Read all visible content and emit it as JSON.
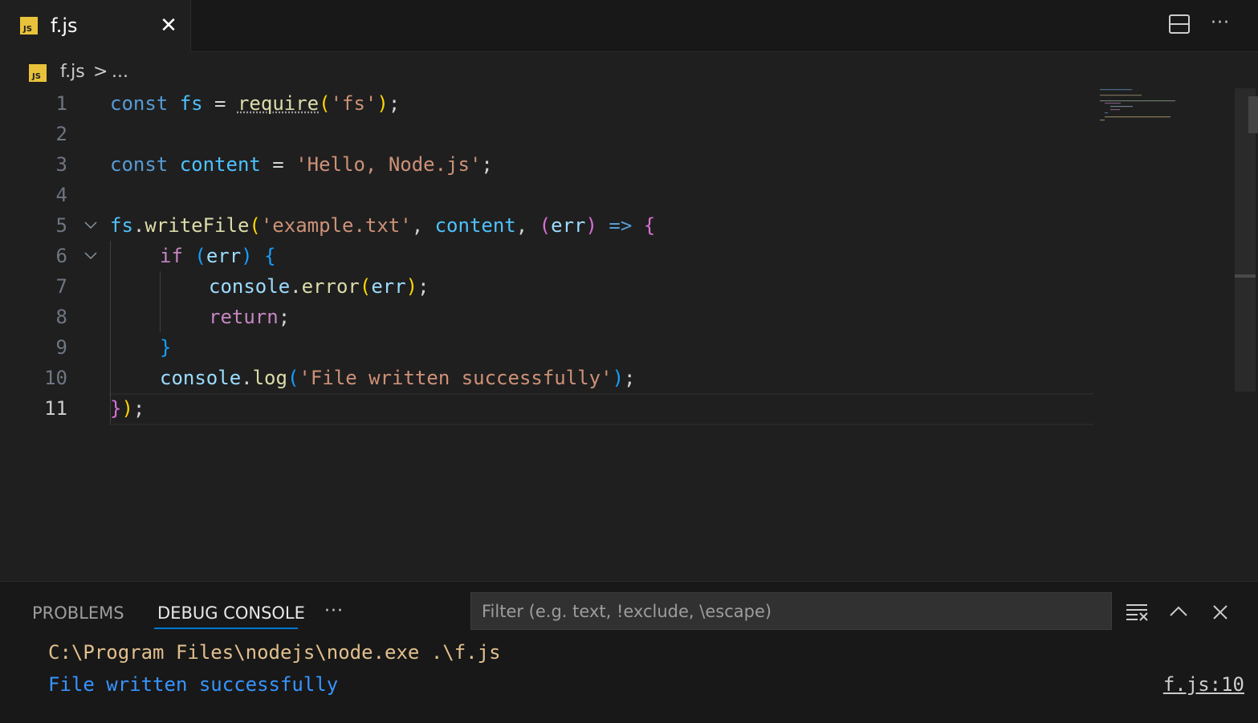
{
  "tab": {
    "icon_text": "JS",
    "label": "f.js",
    "close_glyph": "✕"
  },
  "titlebar": {
    "more_glyph": "···"
  },
  "breadcrumb": {
    "icon_text": "JS",
    "file": "f.js",
    "separator": ">",
    "more": "..."
  },
  "editor": {
    "line_numbers": [
      "1",
      "2",
      "3",
      "4",
      "5",
      "6",
      "7",
      "8",
      "9",
      "10",
      "11"
    ],
    "active_line": "11",
    "tokens": {
      "l1": [
        "const",
        " ",
        "fs",
        " = ",
        "require",
        "(",
        "'fs'",
        ")",
        ";"
      ],
      "l3": [
        "const",
        " ",
        "content",
        " = ",
        "'Hello, Node.js'",
        ";"
      ],
      "l5": [
        "fs",
        ".",
        "writeFile",
        "(",
        "'example.txt'",
        ", ",
        "content",
        ", ",
        "(",
        "err",
        ")",
        " ",
        "=>",
        " ",
        "{"
      ],
      "l6": [
        "if",
        " ",
        "(",
        "err",
        ")",
        " ",
        "{"
      ],
      "l7": [
        "console",
        ".",
        "error",
        "(",
        "err",
        ")",
        ";"
      ],
      "l8": [
        "return",
        ";"
      ],
      "l9": [
        "}"
      ],
      "l10": [
        "console",
        ".",
        "log",
        "(",
        "'File written successfully'",
        ")",
        ";"
      ],
      "l11": [
        "}",
        ")",
        ";"
      ]
    }
  },
  "panel": {
    "tabs": [
      "PROBLEMS",
      "DEBUG CONSOLE"
    ],
    "active_tab": "DEBUG CONSOLE",
    "more_glyph": "···",
    "filter_placeholder": "Filter (e.g. text, !exclude, \\escape)",
    "output": [
      {
        "text": "C:\\Program Files\\nodejs\\node.exe .\\f.js",
        "kind": "command"
      },
      {
        "text": "File written successfully",
        "kind": "log"
      }
    ],
    "source_link": "f.js:10"
  },
  "colors": {
    "keyword": "#569cd6",
    "variable": "#4fc1ff",
    "function": "#dcdcaa",
    "string": "#ce9178",
    "control": "#c586c0",
    "bracket1": "#ffd700",
    "bracket2": "#da70d6",
    "bracket3": "#179fff",
    "js_badge": "#e8c23a",
    "accent": "#0078d4"
  }
}
